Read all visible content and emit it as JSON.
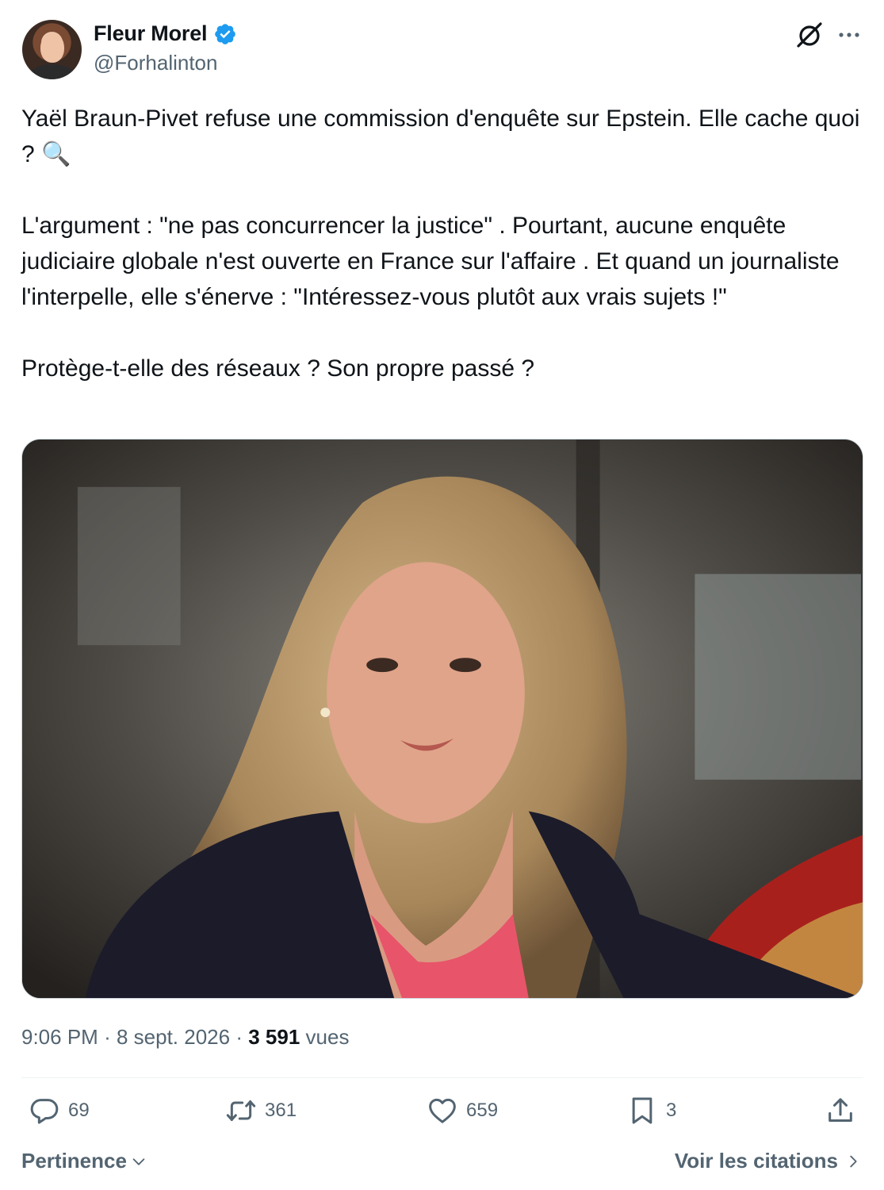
{
  "author": {
    "display_name": "Fleur Morel",
    "handle": "@Forhalinton",
    "verified": true,
    "verified_color": "#1d9bf0"
  },
  "tweet": {
    "paragraphs": [
      "Yaël Braun-Pivet refuse une commission d'enquête sur Epstein. Elle cache quoi ? 🔍",
      "L'argument : \"ne pas concurrencer la justice\" . Pourtant, aucune enquête judiciaire globale n'est ouverte en France sur l'affaire . Et quand un journaliste l'interpelle, elle s'énerve : \"Intéressez-vous plutôt aux vrais sujets !\"",
      "Protège-t-elle des réseaux ? Son propre passé ?"
    ],
    "media_icon": "photo"
  },
  "meta": {
    "time": "9:06 PM",
    "separator": "·",
    "date": "8 sept. 2026",
    "views_count": "3 591",
    "views_label": "vues"
  },
  "actions": {
    "replies": "69",
    "retweets": "361",
    "likes": "659",
    "bookmarks": "3"
  },
  "footer": {
    "sort_label": "Pertinence",
    "quotes_label": "Voir les citations"
  },
  "icons": [
    "grok-icon",
    "more-icon",
    "reply-icon",
    "retweet-icon",
    "like-icon",
    "bookmark-icon",
    "share-icon",
    "chevron-down-icon",
    "chevron-right-icon",
    "verified-icon"
  ]
}
